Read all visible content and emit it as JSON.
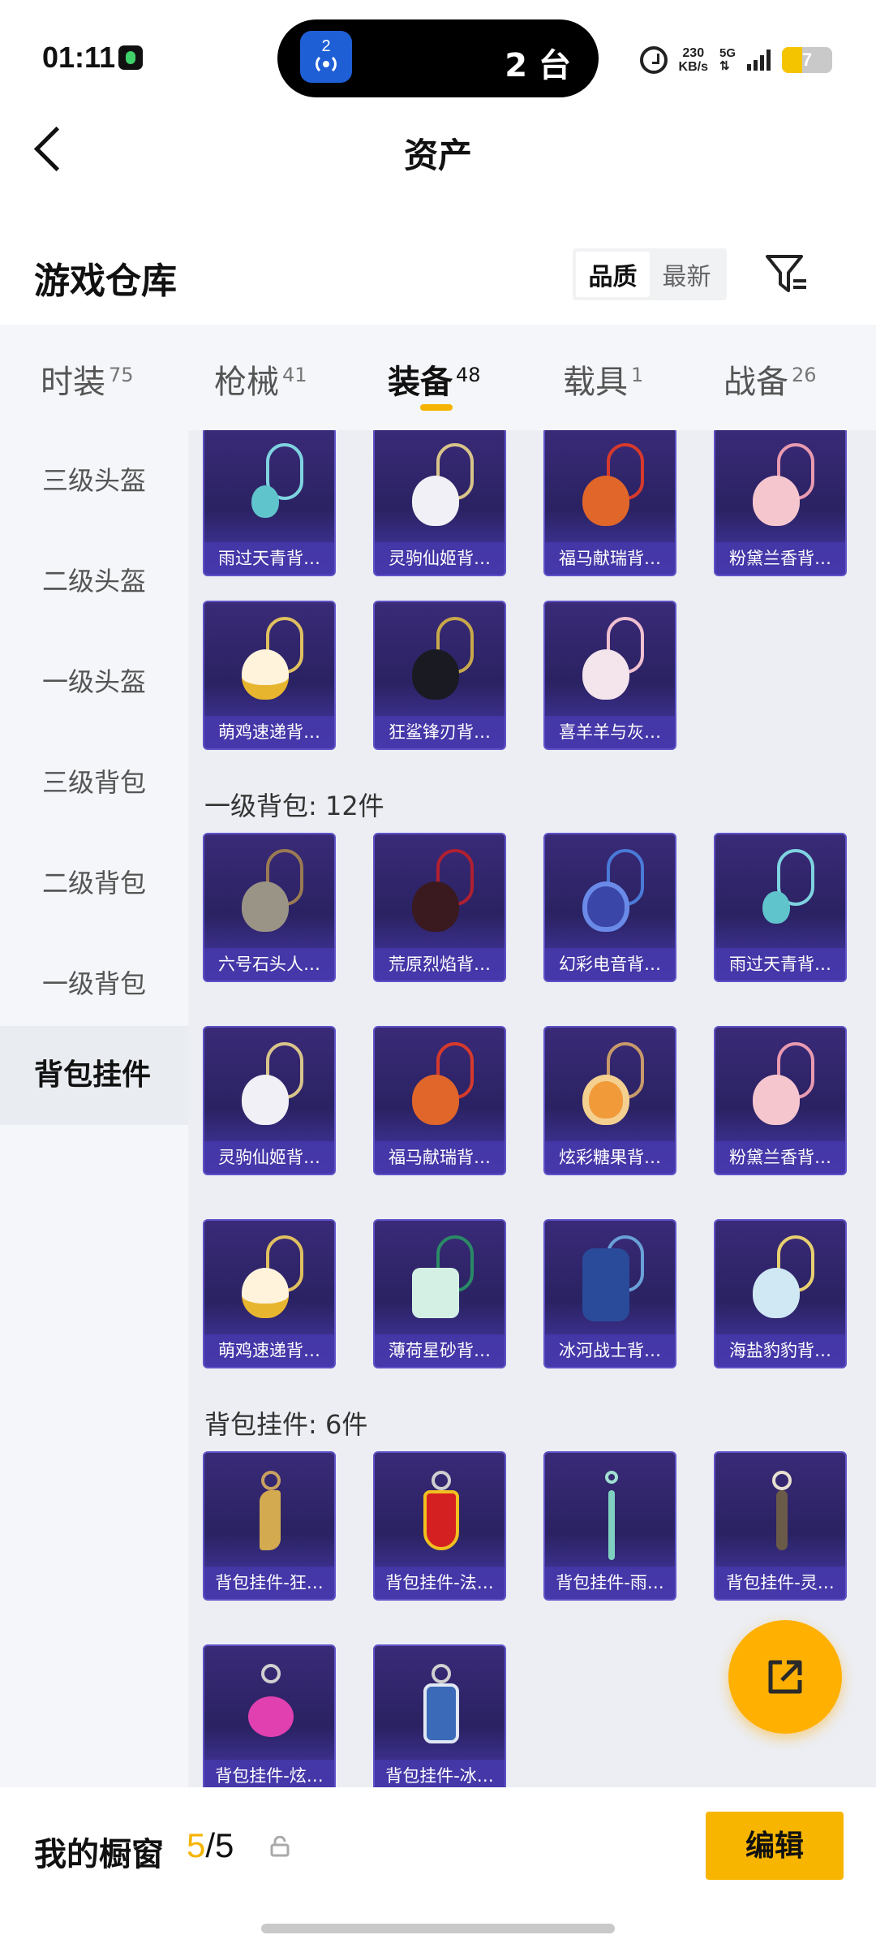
{
  "status_bar": {
    "time": "01:11",
    "island_badge": "2",
    "island_text": "2 台",
    "net_speed_value": "230",
    "net_speed_unit": "KB/s",
    "network": "5G",
    "battery": "7"
  },
  "nav": {
    "title": "资产"
  },
  "warehouse": {
    "title": "游戏仓库",
    "sort_options": [
      "品质",
      "最新"
    ],
    "active_sort": "品质"
  },
  "tabs": [
    {
      "label": "时装",
      "count": "75"
    },
    {
      "label": "枪械",
      "count": "41"
    },
    {
      "label": "装备",
      "count": "48"
    },
    {
      "label": "载具",
      "count": "1"
    },
    {
      "label": "战备",
      "count": "26"
    }
  ],
  "active_tab": "装备",
  "sidebar": {
    "items": [
      "三级头盔",
      "二级头盔",
      "一级头盔",
      "三级背包",
      "二级背包",
      "一级背包",
      "背包挂件"
    ],
    "active": "背包挂件"
  },
  "sections": [
    {
      "title": "",
      "items": [
        "雨过天青背…",
        "灵驹仙姬背…",
        "福马献瑞背…",
        "粉黛兰香背…",
        "萌鸡速递背…",
        "狂鲨锋刃背…",
        "喜羊羊与灰…"
      ]
    },
    {
      "title": "一级背包: 12件",
      "items": [
        "六号石头人…",
        "荒原烈焰背…",
        "幻彩电音背…",
        "雨过天青背…",
        "灵驹仙姬背…",
        "福马献瑞背…",
        "炫彩糖果背…",
        "粉黛兰香背…",
        "萌鸡速递背…",
        "薄荷星砂背…",
        "冰河战士背…",
        "海盐豹豹背…"
      ]
    },
    {
      "title": "背包挂件: 6件",
      "items": [
        "背包挂件-狂…",
        "背包挂件-法…",
        "背包挂件-雨…",
        "背包挂件-灵…",
        "背包挂件-炫…",
        "背包挂件-冰…"
      ]
    }
  ],
  "bottom": {
    "showcase_label": "我的橱窗",
    "showcase_used": "5",
    "showcase_total": "/5",
    "edit_label": "编辑"
  },
  "colors": {
    "accent": "#f7b500",
    "card_bg": "#2a2262",
    "card_label": "#4638aa"
  }
}
